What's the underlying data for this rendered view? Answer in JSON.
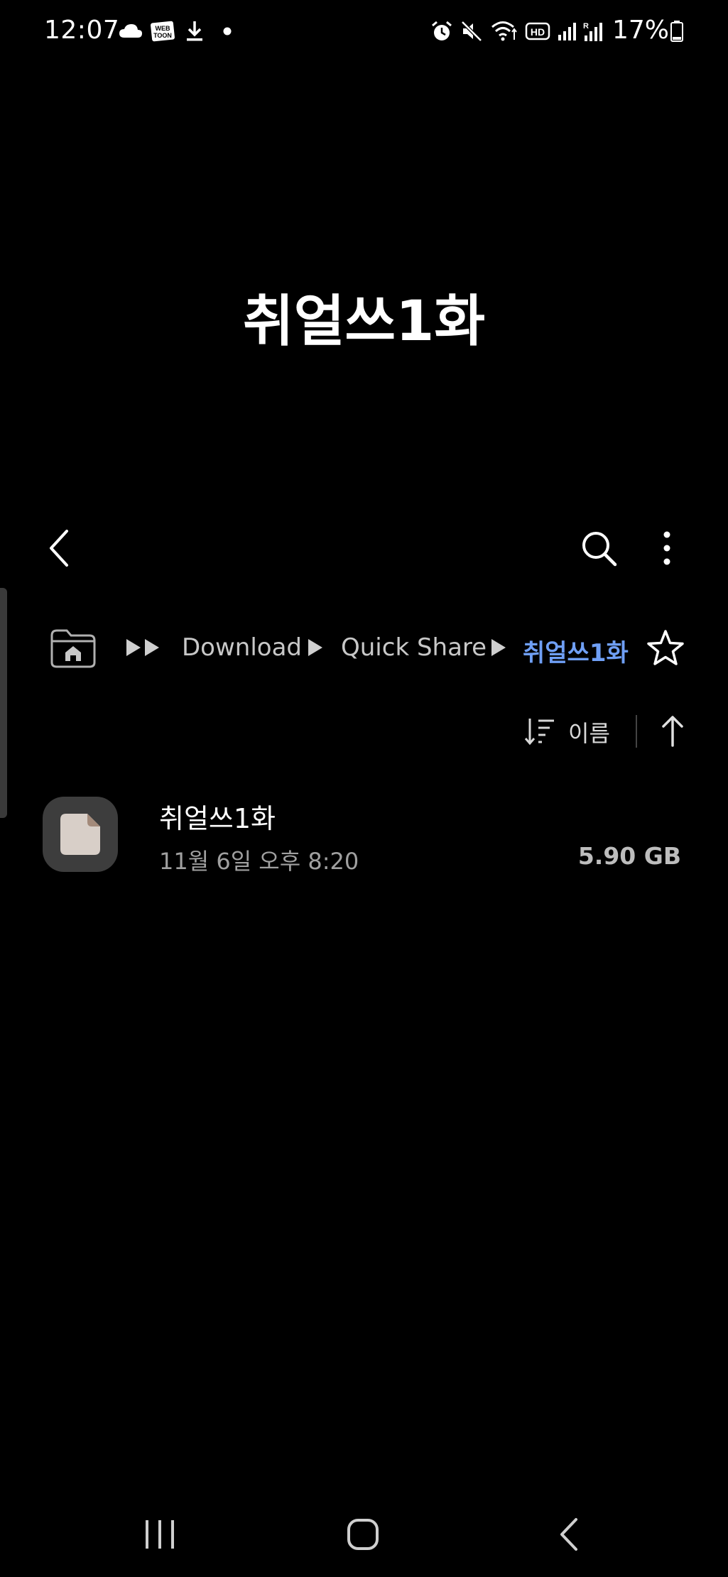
{
  "status_bar": {
    "time": "12:07",
    "battery_percent": "17%",
    "left_icons": [
      "cloud-icon",
      "webtoon-icon",
      "download-icon",
      "dot-icon"
    ],
    "right_icons": [
      "alarm-icon",
      "mute-icon",
      "wifi-icon",
      "hd-icon",
      "signal-icon",
      "signal-roaming-icon",
      "battery-icon"
    ],
    "webtoon_badge": "WEB TOON",
    "hd_badge": "HD"
  },
  "header": {
    "title": "취얼쓰1화"
  },
  "toolbar": {
    "back_icon": "chevron-left-icon",
    "search_icon": "search-icon",
    "more_icon": "more-vertical-icon"
  },
  "breadcrumb": {
    "home_icon": "home-folder-icon",
    "items": [
      "Download",
      "Quick Share",
      "취얼쓰1화"
    ],
    "favorite_icon": "star-icon",
    "accent_color": "#6f9ff5"
  },
  "sort": {
    "label": "이름",
    "sort_icon": "sort-icon",
    "direction_icon": "arrow-up-icon"
  },
  "files": [
    {
      "name": "취얼쓰1화",
      "date": "11월 6일 오후 8:20",
      "size": "5.90 GB",
      "icon": "file-icon"
    }
  ],
  "navigation_bar": {
    "recents_icon": "recents-icon",
    "home_icon": "home-button-icon",
    "back_icon": "back-icon"
  }
}
